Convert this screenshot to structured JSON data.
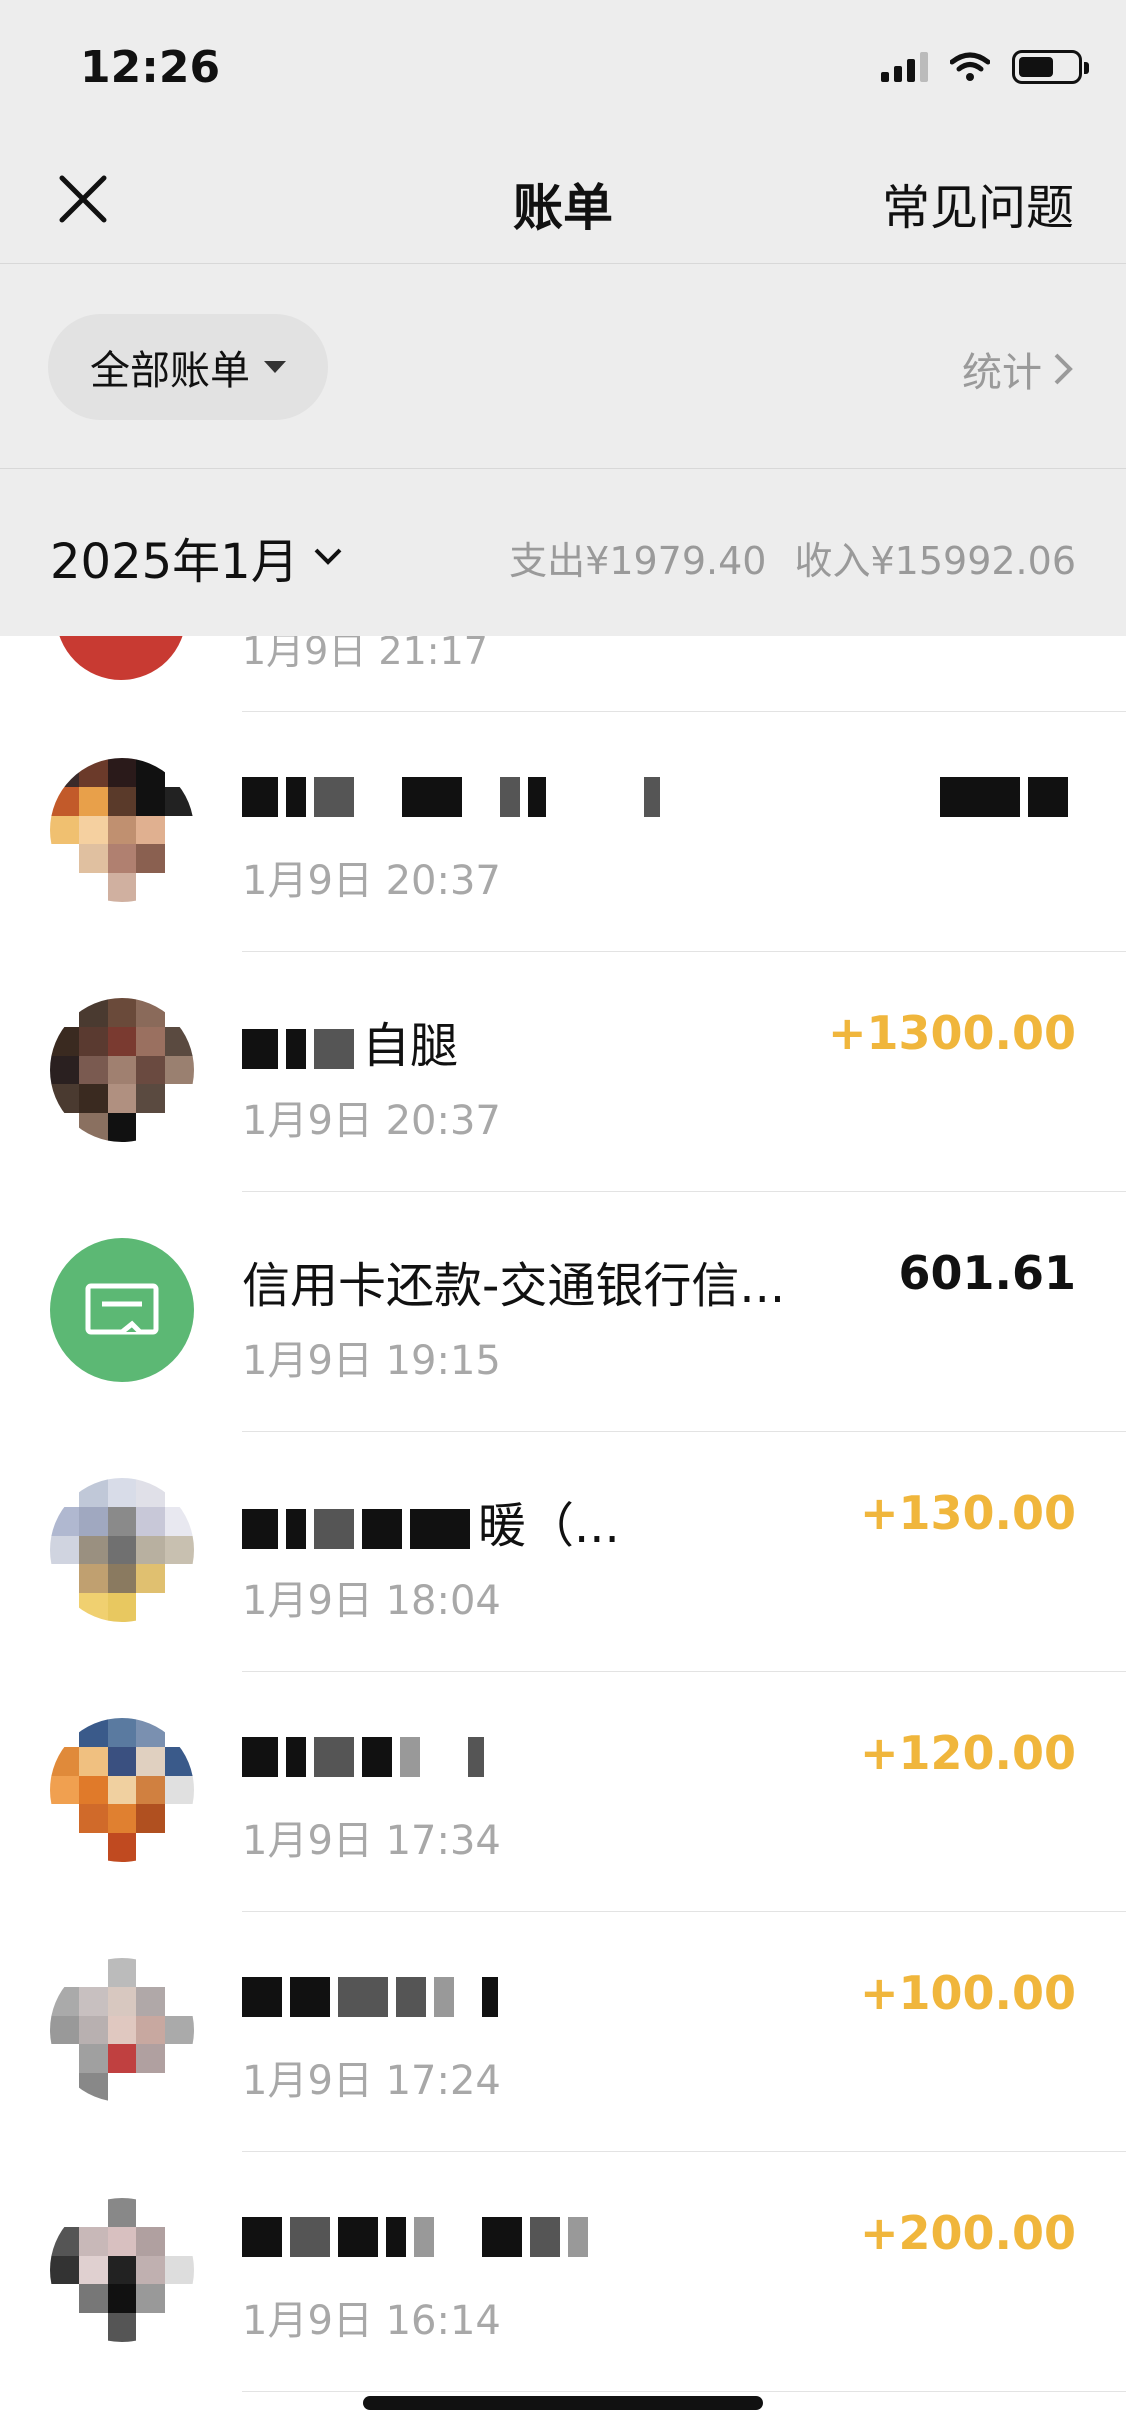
{
  "status_bar": {
    "time": "12:26"
  },
  "nav": {
    "title": "账单",
    "faq_label": "常见问题"
  },
  "filter": {
    "selected": "全部账单",
    "stats_label": "统计"
  },
  "month": {
    "label": "2025年1月",
    "expense_label": "支出",
    "expense_value": "¥1979.40",
    "income_label": "收入",
    "income_value": "¥15992.06"
  },
  "partial_top_row": {
    "time": "1月9日 21:17"
  },
  "transactions": [
    {
      "title": "",
      "time": "1月9日 20:37",
      "amount": "",
      "kind": "income"
    },
    {
      "title": "自腿",
      "time": "1月9日 20:37",
      "amount": "+1300.00",
      "kind": "income"
    },
    {
      "title": "信用卡还款-交通银行信...",
      "time": "1月9日 19:15",
      "amount": "601.61",
      "kind": "expense"
    },
    {
      "title": "暖（...",
      "time": "1月9日 18:04",
      "amount": "+130.00",
      "kind": "income"
    },
    {
      "title": "",
      "time": "1月9日 17:34",
      "amount": "+120.00",
      "kind": "income"
    },
    {
      "title": "",
      "time": "1月9日 17:24",
      "amount": "+100.00",
      "kind": "income"
    },
    {
      "title": "",
      "time": "1月9日 16:14",
      "amount": "+200.00",
      "kind": "income"
    }
  ],
  "colors": {
    "income": "#f0b63c",
    "header_bg": "#ededed",
    "card_icon_bg": "#5cb874"
  }
}
